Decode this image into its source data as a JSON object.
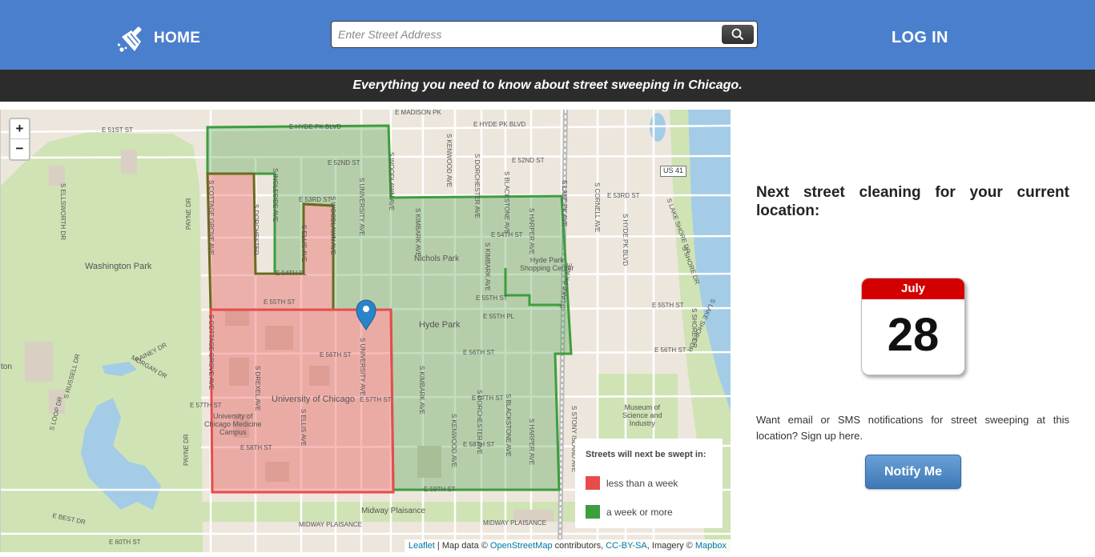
{
  "header": {
    "home_label": "HOME",
    "search_placeholder": "Enter Street Address",
    "login_label": "LOG IN"
  },
  "tagline": "Everything you need to know about street sweeping in Chicago.",
  "map": {
    "zoom_in": "+",
    "zoom_out": "−",
    "streets_horizontal": [
      "E MADISON PK",
      "E 51ST ST",
      "E HYDE PK BLVD",
      "E HYDE PK BLVD",
      "E 52ND ST",
      "E 52ND ST",
      "E 53RD ST",
      "E 53RD ST",
      "E 54TH ST",
      "E 54TH PL",
      "E 55TH ST",
      "E 55TH ST",
      "E 55TH ST",
      "E 55TH PL",
      "E 56TH ST",
      "E 56TH ST",
      "E 56TH ST",
      "E 57TH ST",
      "E 57TH ST",
      "E 57TH ST",
      "E 58TH ST",
      "E 58TH ST",
      "E 59TH ST",
      "Midway Plaisance",
      "MIDWAY PLAISANCE",
      "MIDWAY PLAISANCE",
      "E 60TH ST",
      "E BEST DR"
    ],
    "streets_vertical": [
      "S ELLSWORTH DR",
      "PAYNE DR",
      "S COTTAGE GROVE AVE",
      "S COTTAGE GROVE AVE",
      "S DORCHESTER",
      "S INGLESIDE AVE",
      "S ELLIS AVE",
      "S WOODLAWN AVE",
      "S UNIVERSITY AVE",
      "S UNIVERSITY AVE",
      "S WOODLAWN AVE",
      "S KENWOOD AVE",
      "S DORCHESTER AVE",
      "S BLACKSTONE AVE",
      "S KIMBARK AVE",
      "S HARPER AVE",
      "S LAKE PK AVE",
      "S CORNELL AVE",
      "S HYDE PK BLVD",
      "S LAKE SHORE DR",
      "S SHORE DR",
      "S SHORE DR",
      "S LAKE SHORE DR",
      "S DREXEL AVE",
      "S ELLIS AVE",
      "S KIMBARK AVE",
      "S KENWOOD AVE",
      "S BLACKSTONE AVE",
      "S HARPER AVE",
      "S LAKE PK AVE",
      "S STONY ISLAND AVE",
      "S DORCHESTER AVE",
      "PAYNE DR",
      "S LOOP DR",
      "S RUSSELL DR",
      "RAINEY DR",
      "MORGAN DR",
      "S KIMBARK AVE"
    ],
    "areas": {
      "washington_park": "Washington Park",
      "nichols_park": "Nichols Park",
      "hyde_park_center": "Hyde Park\nShopping Center",
      "hyde_park": "Hyde Park",
      "uchicago": "University of Chicago",
      "uchicago_med": "University of\nChicago Medicine\nCampus",
      "museum": "Museum of\nScience and\nIndustry",
      "ton": "ton",
      "us41": "US 41"
    },
    "legend": {
      "title": "Streets will next be swept in:",
      "items": [
        {
          "label": "less than a week",
          "color": "#e84b4b"
        },
        {
          "label": "a week or more",
          "color": "#3e9d3e"
        }
      ]
    },
    "attribution": {
      "leaflet": "Leaflet",
      "sep1": " | Map data © ",
      "osm": "OpenStreetMap",
      "sep2": " contributors, ",
      "license": "CC-BY-SA",
      "sep3": ", Imagery © ",
      "mapbox": "Mapbox"
    }
  },
  "panel": {
    "title": "Next street cleaning for your current location:",
    "calendar_month": "July",
    "calendar_day": "28",
    "notify_text": "Want email or SMS notifications for street sweeping at this location? Sign up here.",
    "notify_button": "Notify Me"
  },
  "colors": {
    "header_bg": "#4a7fcd",
    "tagline_bg": "#2c2c2c",
    "zone_red": "#e84b4b",
    "zone_green": "#3e9d3e",
    "calendar_red": "#d40000",
    "button_blue": "#3e78b6"
  },
  "icons": [
    "broom-icon",
    "search-icon",
    "map-pin-icon"
  ]
}
